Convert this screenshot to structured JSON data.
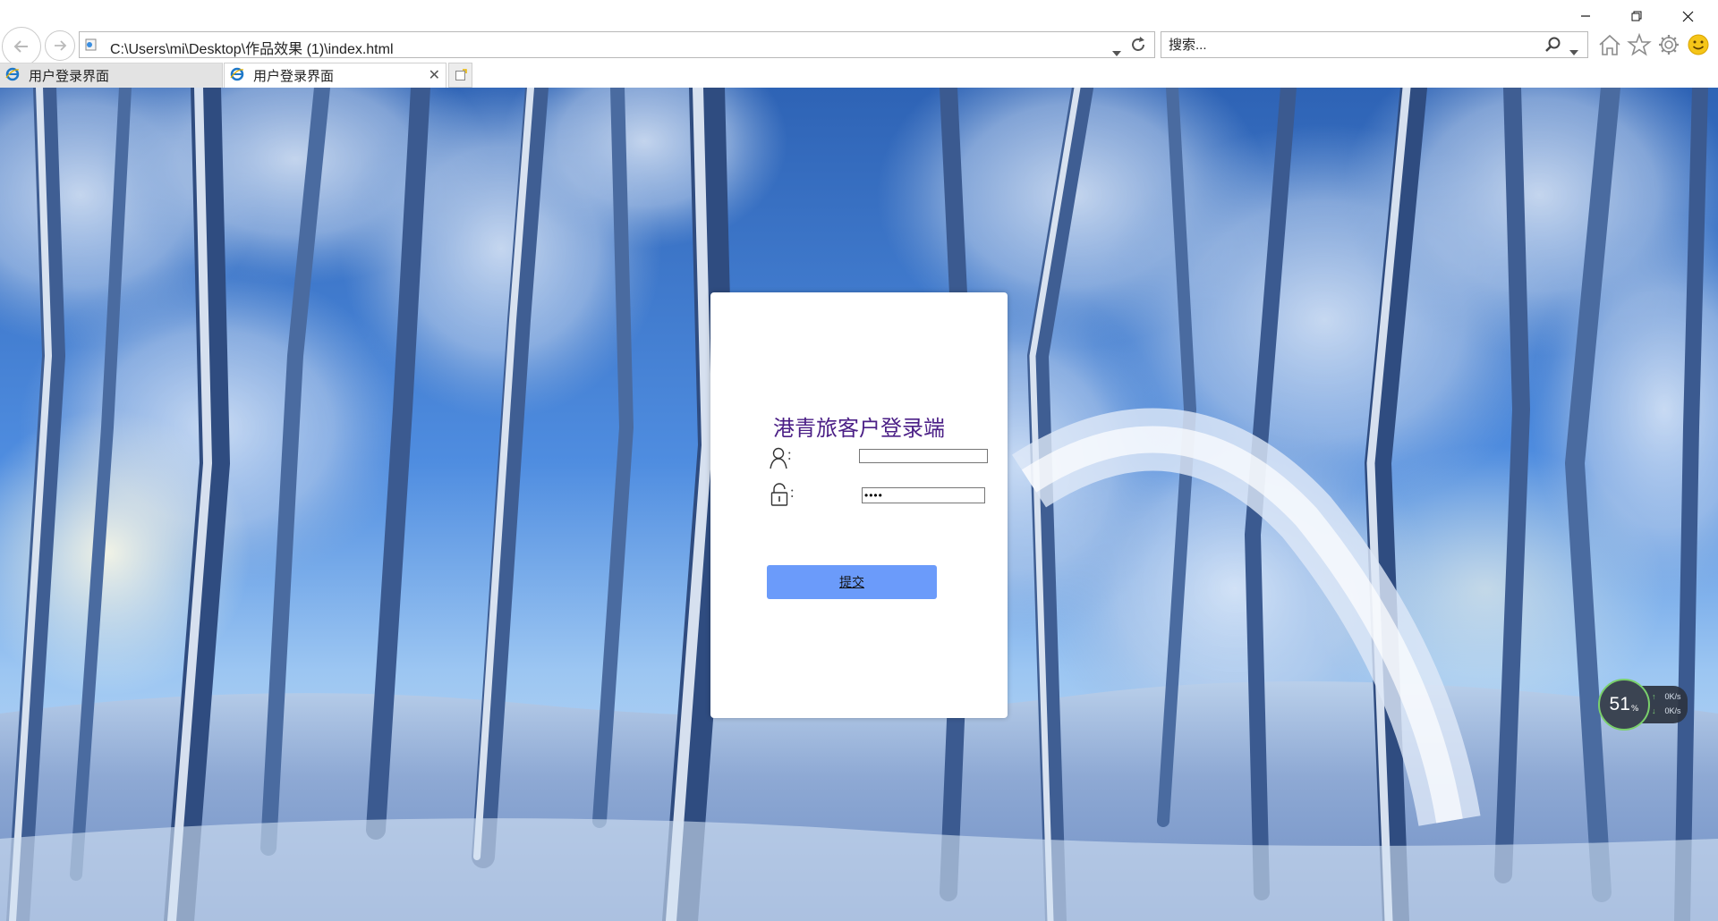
{
  "browser": {
    "address": "C:\\Users\\mi\\Desktop\\作品效果 (1)\\index.html",
    "search_placeholder": "搜索...",
    "tabs": [
      {
        "label": "用户登录界面",
        "active": false
      },
      {
        "label": "用户登录界面",
        "active": true
      }
    ],
    "tab_close_glyph": "✕",
    "accent_color": "#1e78c8"
  },
  "page": {
    "title": "港青旅客户登录端",
    "username_colon": "：",
    "password_colon": "：",
    "username_value": "",
    "password_value": "••••",
    "submit_label": "提交",
    "submit_color": "#6b9bfa",
    "title_color": "#4b1f86"
  },
  "net_widget": {
    "percent": "51",
    "percent_sign": "%",
    "upload": "0K/s",
    "download": "0K/s"
  },
  "icons": {
    "back": "arrow-left-icon",
    "forward": "arrow-right-icon",
    "refresh": "refresh-icon",
    "search": "search-icon",
    "home": "home-icon",
    "favorites": "star-icon",
    "settings": "gear-icon",
    "feedback": "smiley-icon",
    "user": "user-icon",
    "lock": "lock-icon"
  }
}
